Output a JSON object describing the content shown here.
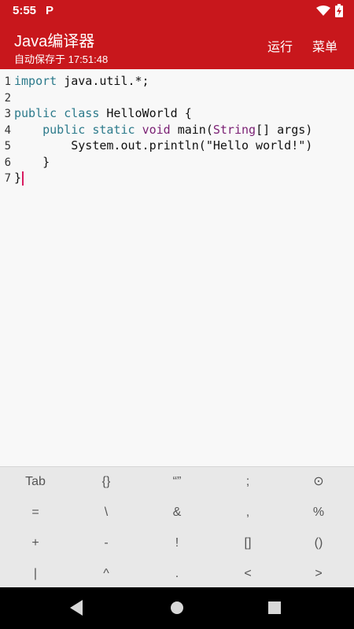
{
  "status": {
    "time": "5:55",
    "app_glyph": "P"
  },
  "appbar": {
    "title": "Java编译器",
    "subtitle": "自动保存于 17:51:48",
    "run_label": "运行",
    "menu_label": "菜单",
    "bg_color": "#c8171c"
  },
  "editor": {
    "line_numbers": [
      "1",
      "2",
      "3",
      "4",
      "5",
      "6",
      "7"
    ],
    "lines": [
      [
        {
          "t": "import",
          "c": "kw"
        },
        {
          "t": " java.util.*;",
          "c": ""
        }
      ],
      [],
      [
        {
          "t": "public",
          "c": "kw"
        },
        {
          "t": " ",
          "c": ""
        },
        {
          "t": "class",
          "c": "kw"
        },
        {
          "t": " HelloWorld {",
          "c": ""
        }
      ],
      [
        {
          "t": "    ",
          "c": ""
        },
        {
          "t": "public",
          "c": "kw"
        },
        {
          "t": " ",
          "c": ""
        },
        {
          "t": "static",
          "c": "kw"
        },
        {
          "t": " ",
          "c": ""
        },
        {
          "t": "void",
          "c": "kw2"
        },
        {
          "t": " main(",
          "c": ""
        },
        {
          "t": "String",
          "c": "kw2"
        },
        {
          "t": "[] args)",
          "c": ""
        }
      ],
      [
        {
          "t": "        System.out.println(\"Hello world!\")",
          "c": ""
        }
      ],
      [
        {
          "t": "    }",
          "c": ""
        }
      ],
      [
        {
          "t": "}",
          "c": ""
        }
      ]
    ]
  },
  "keys": [
    [
      "Tab",
      "{}",
      "“”",
      ";",
      "⊙"
    ],
    [
      "=",
      "\\",
      "&",
      ",",
      "%"
    ],
    [
      "+",
      "-",
      "!",
      "[]",
      "()"
    ],
    [
      "|",
      "^",
      ".",
      "<",
      ">"
    ]
  ]
}
